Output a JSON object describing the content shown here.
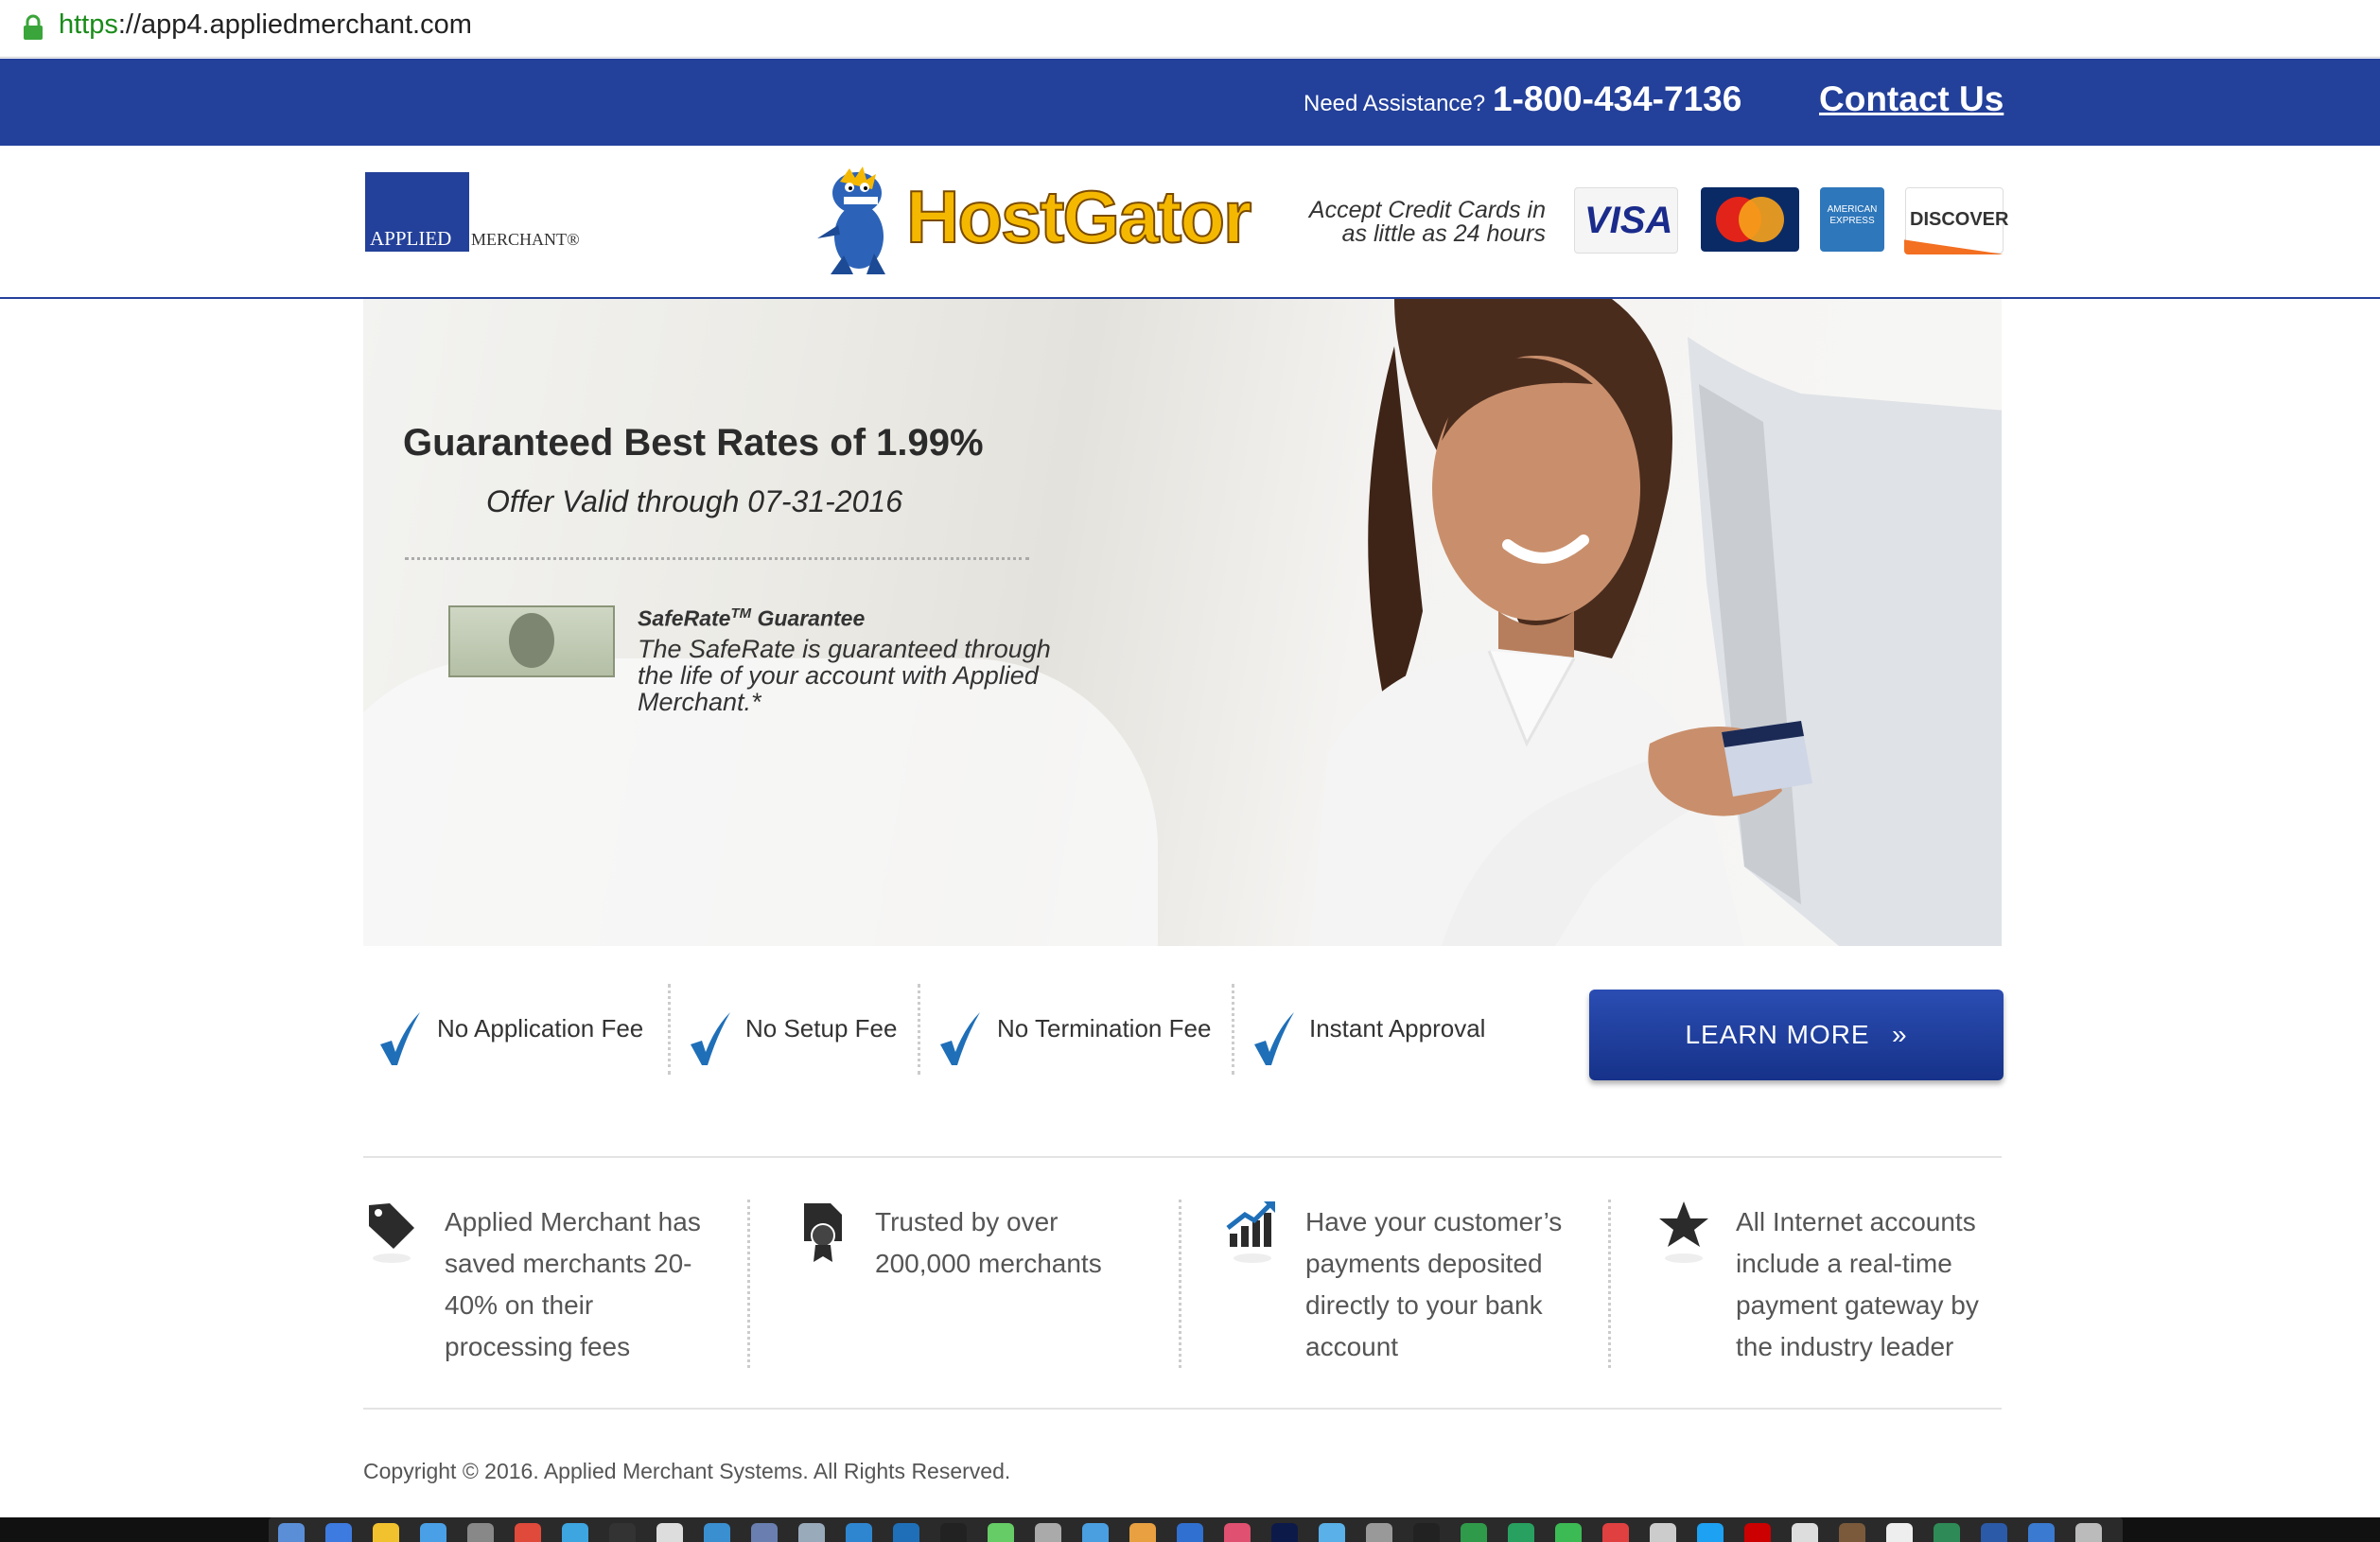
{
  "browser": {
    "url_scheme": "https",
    "url_rest": "://app4.appliedmerchant.com"
  },
  "topbar": {
    "assist_label": "Need Assistance?",
    "phone": "1-800-434-7136",
    "contact_label": "Contact Us"
  },
  "header": {
    "logo_applied": "APPLIED",
    "logo_merchant": "MERCHANT®",
    "partner_name": "HostGator",
    "accept_text": "Accept Credit Cards in as little as 24 hours",
    "cards": {
      "visa": "VISA",
      "amex": "AMERICAN EXPRESS",
      "discover": "DISCOVER"
    }
  },
  "hero": {
    "title": "Guaranteed Best Rates of 1.99%",
    "offer": "Offer Valid through 07-31-2016",
    "safe_title": "SafeRate",
    "safe_tm": "TM",
    "safe_title_tail": " Guarantee",
    "safe_body": "The SafeRate is guaranteed through the life of your account with Applied Merchant.*"
  },
  "features": [
    {
      "label": "No Application Fee"
    },
    {
      "label": "No Setup Fee"
    },
    {
      "label": "No Termination Fee"
    },
    {
      "label": "Instant Approval"
    }
  ],
  "cta": {
    "label": "LEARN MORE",
    "chevron": "»"
  },
  "benefits": [
    {
      "icon": "tag-icon",
      "text": "Applied Merchant has saved merchants 20-40% on their processing fees"
    },
    {
      "icon": "ribbon-badge-icon",
      "text": "Trusted by over 200,000 merchants"
    },
    {
      "icon": "growth-chart-icon",
      "text": "Have your customer’s payments deposited directly to your bank account"
    },
    {
      "icon": "star-icon",
      "text": "All Internet accounts include a real-time payment gateway by the industry leader"
    }
  ],
  "footer": {
    "copyright": "Copyright © 2016. Applied Merchant Systems. All Rights Reserved."
  },
  "colors": {
    "brand_blue": "#23409a",
    "check_blue": "#1f6fb8",
    "gator_yellow": "#f5b800"
  }
}
